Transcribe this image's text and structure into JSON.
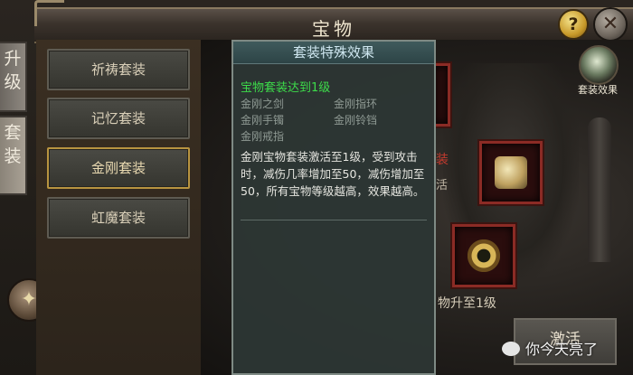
{
  "window": {
    "title": "宝物"
  },
  "side_tabs": [
    {
      "label": "升级"
    },
    {
      "label": "套装"
    }
  ],
  "set_list": [
    {
      "label": "祈祷套装",
      "active": false
    },
    {
      "label": "记忆套装",
      "active": false
    },
    {
      "label": "金刚套装",
      "active": true
    },
    {
      "label": "虹魔套装",
      "active": false
    }
  ],
  "buttons": {
    "help": "?",
    "close": "✕",
    "activate": "激活"
  },
  "effect_button": {
    "label": "套装效果"
  },
  "scene_text": {
    "partial_red": "装",
    "partial_grey": "活",
    "upgrade_hint": "物升至1级"
  },
  "tooltip": {
    "title": "套装特殊效果",
    "threshold": "宝物套装达到1级",
    "items": [
      "金刚之剑",
      "金刚指环",
      "金刚手镯",
      "金刚铃铛",
      "金刚戒指"
    ],
    "description": "金刚宝物套装激活至1级，受到攻击时，减伤几率增加至50，减伤增加至50，所有宝物等级越高，效果越高。"
  },
  "watermark": {
    "text": "你今天亮了"
  },
  "colors": {
    "threshold_green": "#3ddc4a",
    "active_border": "#b89440",
    "slot_border": "#8b2b25"
  }
}
